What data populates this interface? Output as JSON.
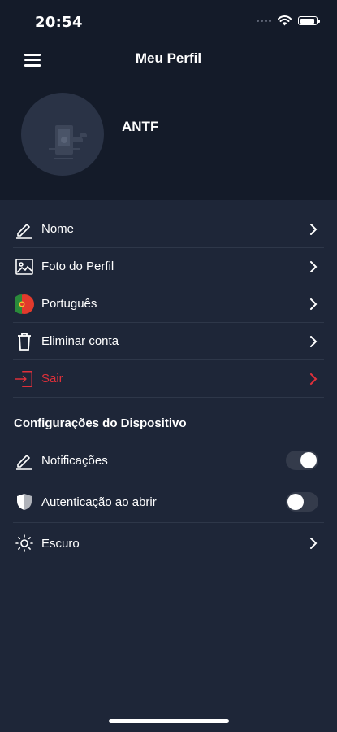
{
  "status": {
    "time": "20:54"
  },
  "header": {
    "title": "Meu Perfil"
  },
  "profile": {
    "name": "ANTF"
  },
  "menu": [
    {
      "label": "Nome",
      "icon": "pencil-icon"
    },
    {
      "label": "Foto do Perfil",
      "icon": "image-icon"
    },
    {
      "label": "Português",
      "icon": "portugal-flag-icon"
    },
    {
      "label": "Eliminar conta",
      "icon": "trash-icon"
    },
    {
      "label": "Sair",
      "icon": "logout-icon"
    }
  ],
  "device_settings": {
    "title": "Configurações do Dispositivo",
    "items": [
      {
        "label": "Notificações",
        "icon": "pencil-icon",
        "toggle": true
      },
      {
        "label": "Autenticação ao abrir",
        "icon": "shield-icon",
        "toggle": false
      },
      {
        "label": "Escuro",
        "icon": "sun-icon"
      }
    ]
  },
  "colors": {
    "header_bg": "#141b29",
    "body_bg": "#1e2638",
    "danger": "#e0303a"
  }
}
